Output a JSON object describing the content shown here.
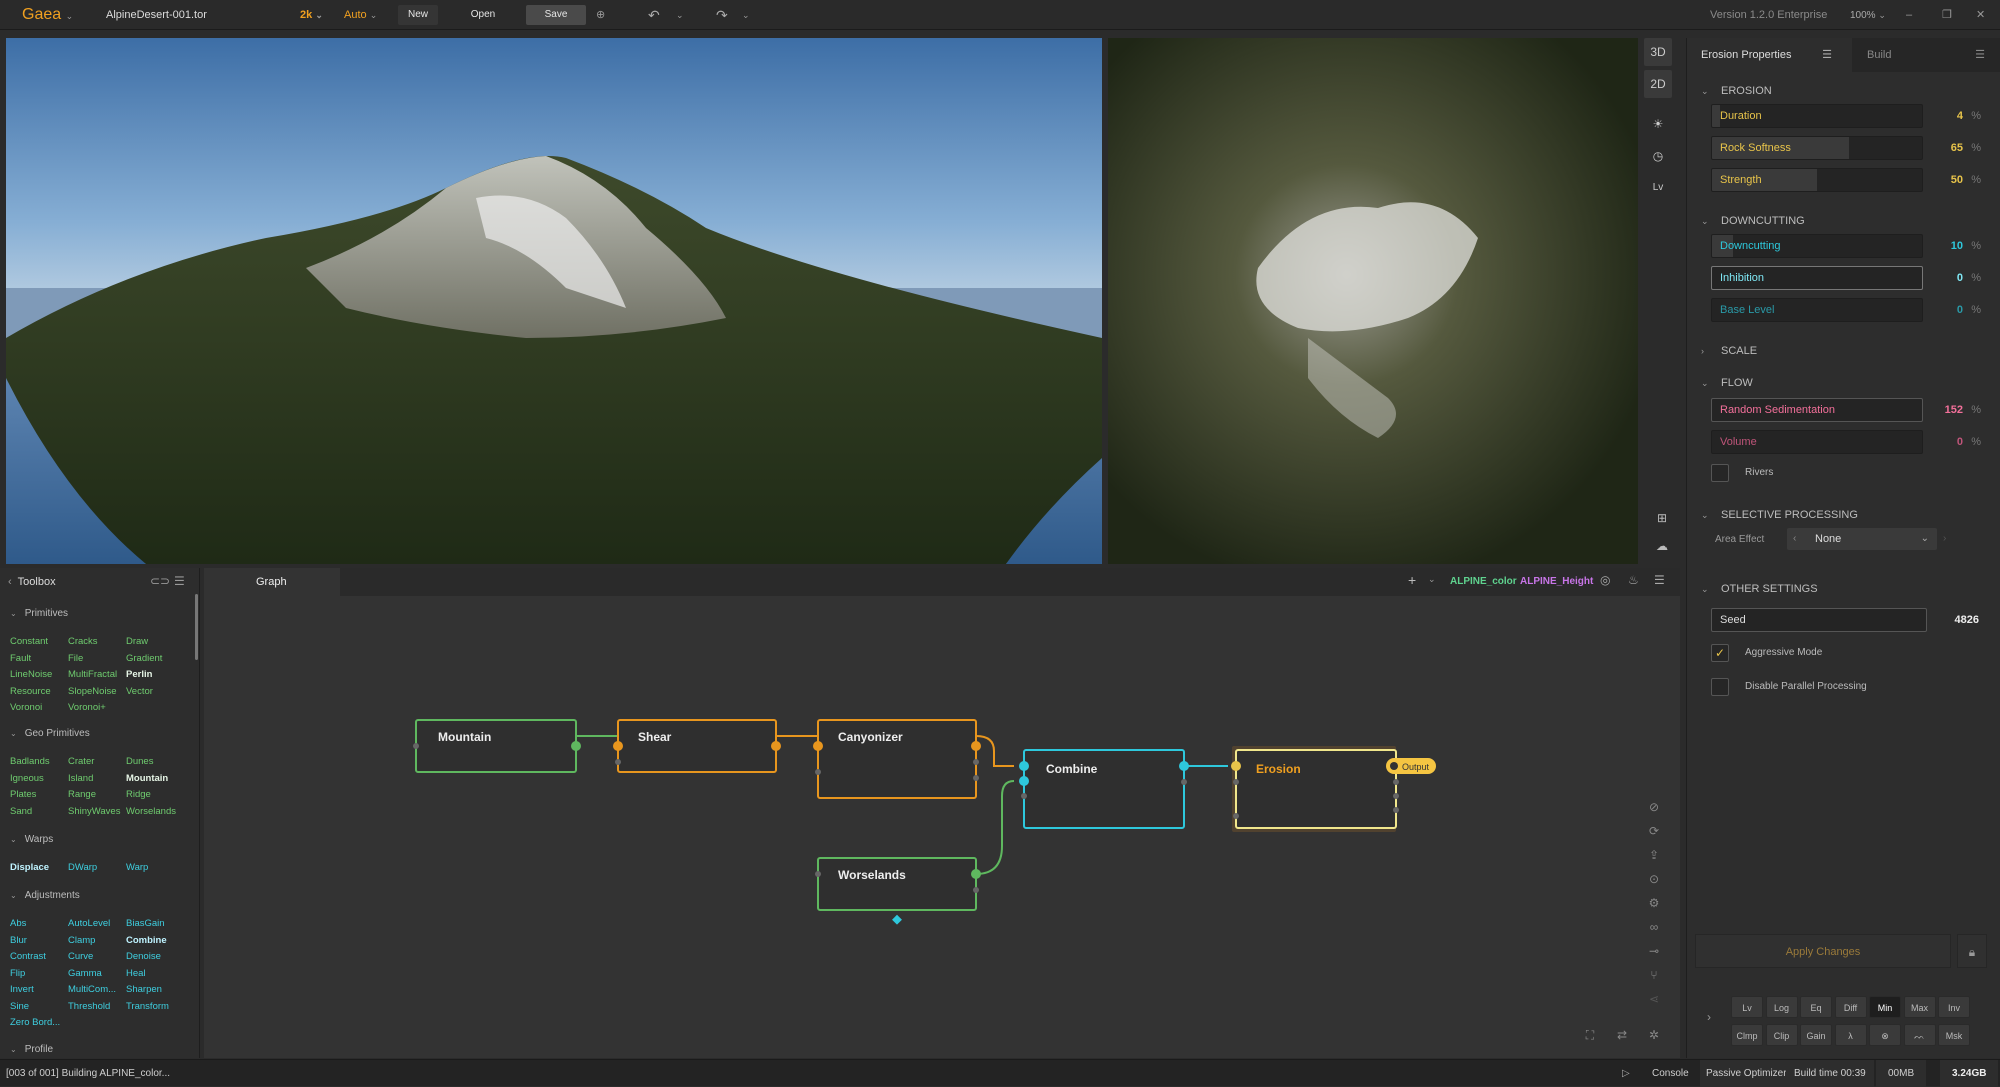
{
  "topbar": {
    "app_name": "Gaea",
    "file_name": "AlpineDesert-001.tor",
    "resolution": "2k",
    "mode": "Auto",
    "new_label": "New",
    "open_label": "Open",
    "save_label": "Save",
    "version": "Version 1.2.0 Enterprise",
    "zoom": "100%"
  },
  "viewport_tools": {
    "btn_3d": "3D",
    "btn_2d": "2D",
    "btn_lv": "Lv"
  },
  "properties": {
    "tab_active": "Erosion Properties",
    "tab_inactive": "Build",
    "sections": {
      "erosion": "EROSION",
      "downcutting": "DOWNCUTTING",
      "scale": "SCALE",
      "flow": "FLOW",
      "selective": "SELECTIVE PROCESSING",
      "other": "OTHER SETTINGS"
    },
    "params": {
      "duration": {
        "label": "Duration",
        "value": "4",
        "unit": "%",
        "fill": 0.04
      },
      "rock_softness": {
        "label": "Rock Softness",
        "value": "65",
        "unit": "%",
        "fill": 0.65
      },
      "strength": {
        "label": "Strength",
        "value": "50",
        "unit": "%",
        "fill": 0.5
      },
      "downcutting": {
        "label": "Downcutting",
        "value": "10",
        "unit": "%",
        "fill": 0.1
      },
      "inhibition": {
        "label": "Inhibition",
        "value": "0",
        "unit": "%",
        "fill": 0
      },
      "base_level": {
        "label": "Base Level",
        "value": "0",
        "unit": "%",
        "fill": 0
      },
      "random_sed": {
        "label": "Random Sedimentation",
        "value": "152",
        "unit": "%",
        "fill": 0
      },
      "volume": {
        "label": "Volume",
        "value": "0",
        "unit": "%",
        "fill": 0
      },
      "rivers": {
        "label": "Rivers",
        "checked": false
      },
      "area_effect": {
        "label": "Area Effect",
        "value": "None"
      },
      "seed": {
        "label": "Seed",
        "value": "4826"
      },
      "aggressive": {
        "label": "Aggressive Mode",
        "checked": true
      },
      "disable_parallel": {
        "label": "Disable Parallel Processing",
        "checked": false
      }
    },
    "apply_label": "Apply Changes",
    "bottom_row1": [
      "Lv",
      "Log",
      "Eq",
      "Diff",
      "Min",
      "Max",
      "Inv"
    ],
    "bottom_row2": [
      "Clmp",
      "Clip",
      "Gain",
      "",
      "",
      "",
      "Msk"
    ]
  },
  "toolbox": {
    "title": "Toolbox",
    "categories": {
      "primitives": "Primitives",
      "geo": "Geo Primitives",
      "warps": "Warps",
      "adjustments": "Adjustments",
      "profile": "Profile"
    },
    "primitives": [
      "Constant",
      "Cracks",
      "Draw",
      "Fault",
      "File",
      "Gradient",
      "LineNoise",
      "MultiFractal",
      "Perlin",
      "Resource",
      "SlopeNoise",
      "Vector",
      "Voronoi",
      "Voronoi+"
    ],
    "geo": [
      "Badlands",
      "Crater",
      "Dunes",
      "Igneous",
      "Island",
      "Mountain",
      "Plates",
      "Range",
      "Ridge",
      "Sand",
      "ShinyWaves",
      "Worselands"
    ],
    "warps": [
      "Displace",
      "DWarp",
      "Warp"
    ],
    "adjustments": [
      "Abs",
      "AutoLevel",
      "BiasGain",
      "Blur",
      "Clamp",
      "Combine",
      "Contrast",
      "Curve",
      "Denoise",
      "Flip",
      "Gamma",
      "Heal",
      "Invert",
      "MultiCom...",
      "Sharpen",
      "Sine",
      "Threshold",
      "Transform",
      "Zero Bord..."
    ]
  },
  "graph": {
    "tab": "Graph",
    "color_out": "ALPINE_color",
    "height_out": "ALPINE_Height",
    "nodes": {
      "mountain": "Mountain",
      "shear": "Shear",
      "canyonizer": "Canyonizer",
      "combine": "Combine",
      "erosion": "Erosion",
      "worselands": "Worselands"
    },
    "output_tag": "Output"
  },
  "status": {
    "build_msg": "[003 of 001] Building ALPINE_color...",
    "console": "Console",
    "optimizer": "Passive Optimizer",
    "build_time": "Build time 00:39",
    "memory": "00MB",
    "disk": "3.24GB"
  },
  "colors": {
    "accent": "#f0a020",
    "green": "#5fb85f",
    "orange": "#e8961e",
    "cyan": "#2ec8dc",
    "yellow": "#f5c542",
    "pink": "#e85a8a"
  }
}
